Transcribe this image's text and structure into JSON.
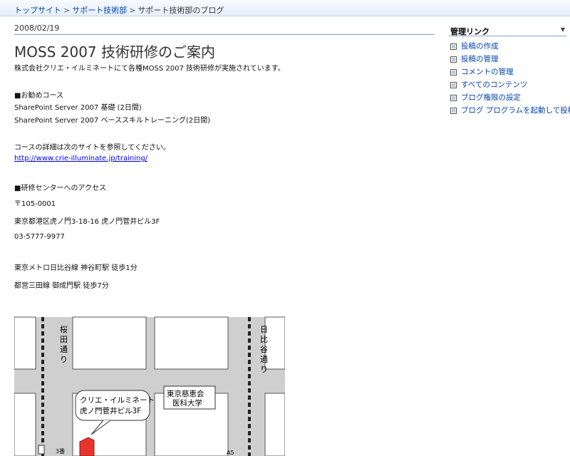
{
  "breadcrumb": {
    "top_site": "トップサイト",
    "support": "サポート技術部",
    "current": "サポート技術部のブログ",
    "separator": ">"
  },
  "post": {
    "date": "2008/02/19",
    "title": "MOSS 2007 技術研修のご案内",
    "intro": "株式会社クリエ・イルミネートにて各種MOSS 2007 技術研修が実施されています。",
    "courses_heading": "■お勧めコース",
    "course1": "SharePoint Server 2007 基礎 (2日間)",
    "course2": "SharePoint Server 2007 ベーススキルトレーニング(2日間)",
    "details_text": "コースの詳細は次のサイトを参照してください。",
    "details_link": "http://www.crie-illuminate.jp/training/",
    "access_heading": "■研修センターへのアクセス",
    "postal": "〒105-0001",
    "address": "東京都港区虎ノ門3-18-16  虎ノ門菅井ビル3F",
    "phone": "03-5777-9977",
    "access1": "東京メトロ日比谷線  神谷町駅  徒歩1分",
    "access2": "都営三田線  御成門駅  徒歩7分"
  },
  "map": {
    "street_left_1": "桜",
    "street_left_2": "田",
    "street_left_3": "通",
    "street_left_4": "り",
    "street_right_1": "日",
    "street_right_2": "比",
    "street_right_3": "谷",
    "street_right_4": "通",
    "street_right_5": "り",
    "callout_line1": "クリエ・イルミネート",
    "callout_line2": "虎ノ門菅井ビル3F",
    "building_line1": "東京慈恵会",
    "building_line2": "医科大学",
    "label_3ban": "3番",
    "label_a5": "A5"
  },
  "sidebar": {
    "title": "管理リンク",
    "caret": "▼",
    "links": [
      "投稿の作成",
      "投稿の管理",
      "コメントの管理",
      "すべてのコンテンツ",
      "ブログ権限の設定",
      "ブログ プログラムを起動して投稿"
    ]
  },
  "colors": {
    "link": "#0645ad",
    "rule": "#7fa0cd",
    "road": "#cccccc",
    "building_red": "#e8342e"
  }
}
